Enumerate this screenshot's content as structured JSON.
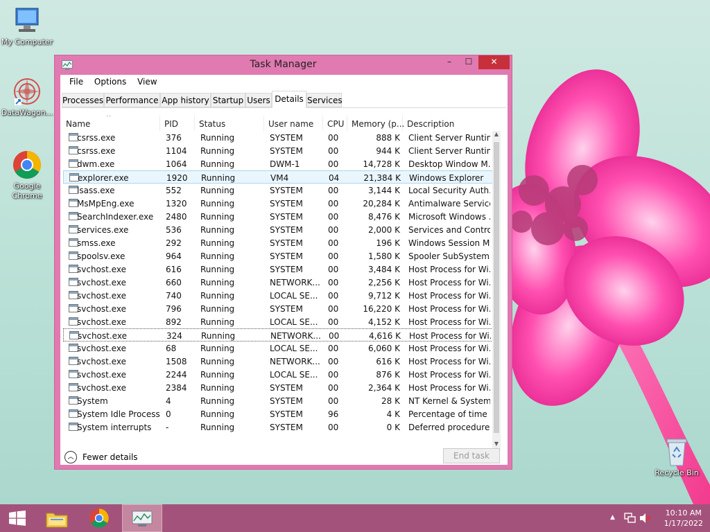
{
  "desktop": {
    "icons": [
      {
        "label": "My Computer"
      },
      {
        "label": "DataWagon..."
      },
      {
        "label": "Google Chrome"
      },
      {
        "label": "Recycle Bin"
      }
    ]
  },
  "window": {
    "title": "Task Manager",
    "controls": {
      "minimize": "–",
      "maximize": "☐",
      "close": "✕"
    },
    "menu": [
      "File",
      "Options",
      "View"
    ],
    "tabs": [
      {
        "label": "Processes",
        "active": false
      },
      {
        "label": "Performance",
        "active": false
      },
      {
        "label": "App history",
        "active": false
      },
      {
        "label": "Startup",
        "active": false
      },
      {
        "label": "Users",
        "active": false
      },
      {
        "label": "Details",
        "active": true
      },
      {
        "label": "Services",
        "active": false
      }
    ],
    "columns": [
      "Name",
      "PID",
      "Status",
      "User name",
      "CPU",
      "Memory (p...",
      "Description"
    ],
    "sort_indicator": "^",
    "rows": [
      {
        "name": "csrss.exe",
        "pid": "376",
        "status": "Running",
        "user": "SYSTEM",
        "cpu": "00",
        "mem": "888 K",
        "desc": "Client Server Runtim..."
      },
      {
        "name": "csrss.exe",
        "pid": "1104",
        "status": "Running",
        "user": "SYSTEM",
        "cpu": "00",
        "mem": "944 K",
        "desc": "Client Server Runtim..."
      },
      {
        "name": "dwm.exe",
        "pid": "1064",
        "status": "Running",
        "user": "DWM-1",
        "cpu": "00",
        "mem": "14,728 K",
        "desc": "Desktop Window M..."
      },
      {
        "name": "explorer.exe",
        "pid": "1920",
        "status": "Running",
        "user": "VM4",
        "cpu": "04",
        "mem": "21,384 K",
        "desc": "Windows Explorer"
      },
      {
        "name": "lsass.exe",
        "pid": "552",
        "status": "Running",
        "user": "SYSTEM",
        "cpu": "00",
        "mem": "3,144 K",
        "desc": "Local Security Auth..."
      },
      {
        "name": "MsMpEng.exe",
        "pid": "1320",
        "status": "Running",
        "user": "SYSTEM",
        "cpu": "00",
        "mem": "20,284 K",
        "desc": "Antimalware Service..."
      },
      {
        "name": "SearchIndexer.exe",
        "pid": "2480",
        "status": "Running",
        "user": "SYSTEM",
        "cpu": "00",
        "mem": "8,476 K",
        "desc": "Microsoft Windows ..."
      },
      {
        "name": "services.exe",
        "pid": "536",
        "status": "Running",
        "user": "SYSTEM",
        "cpu": "00",
        "mem": "2,000 K",
        "desc": "Services and Control..."
      },
      {
        "name": "smss.exe",
        "pid": "292",
        "status": "Running",
        "user": "SYSTEM",
        "cpu": "00",
        "mem": "196 K",
        "desc": "Windows Session M..."
      },
      {
        "name": "spoolsv.exe",
        "pid": "964",
        "status": "Running",
        "user": "SYSTEM",
        "cpu": "00",
        "mem": "1,580 K",
        "desc": "Spooler SubSystem ..."
      },
      {
        "name": "svchost.exe",
        "pid": "616",
        "status": "Running",
        "user": "SYSTEM",
        "cpu": "00",
        "mem": "3,484 K",
        "desc": "Host Process for Wi..."
      },
      {
        "name": "svchost.exe",
        "pid": "660",
        "status": "Running",
        "user": "NETWORK...",
        "cpu": "00",
        "mem": "2,256 K",
        "desc": "Host Process for Wi..."
      },
      {
        "name": "svchost.exe",
        "pid": "740",
        "status": "Running",
        "user": "LOCAL SE...",
        "cpu": "00",
        "mem": "9,712 K",
        "desc": "Host Process for Wi..."
      },
      {
        "name": "svchost.exe",
        "pid": "796",
        "status": "Running",
        "user": "SYSTEM",
        "cpu": "00",
        "mem": "16,220 K",
        "desc": "Host Process for Wi..."
      },
      {
        "name": "svchost.exe",
        "pid": "892",
        "status": "Running",
        "user": "LOCAL SE...",
        "cpu": "00",
        "mem": "4,152 K",
        "desc": "Host Process for Wi..."
      },
      {
        "name": "svchost.exe",
        "pid": "324",
        "status": "Running",
        "user": "NETWORK...",
        "cpu": "00",
        "mem": "4,616 K",
        "desc": "Host Process for Wi..."
      },
      {
        "name": "svchost.exe",
        "pid": "68",
        "status": "Running",
        "user": "LOCAL SE...",
        "cpu": "00",
        "mem": "6,060 K",
        "desc": "Host Process for Wi..."
      },
      {
        "name": "svchost.exe",
        "pid": "1508",
        "status": "Running",
        "user": "NETWORK...",
        "cpu": "00",
        "mem": "616 K",
        "desc": "Host Process for Wi..."
      },
      {
        "name": "svchost.exe",
        "pid": "2244",
        "status": "Running",
        "user": "LOCAL SE...",
        "cpu": "00",
        "mem": "876 K",
        "desc": "Host Process for Wi..."
      },
      {
        "name": "svchost.exe",
        "pid": "2384",
        "status": "Running",
        "user": "SYSTEM",
        "cpu": "00",
        "mem": "2,364 K",
        "desc": "Host Process for Wi..."
      },
      {
        "name": "System",
        "pid": "4",
        "status": "Running",
        "user": "SYSTEM",
        "cpu": "00",
        "mem": "28 K",
        "desc": "NT Kernel & System"
      },
      {
        "name": "System Idle Process",
        "pid": "0",
        "status": "Running",
        "user": "SYSTEM",
        "cpu": "96",
        "mem": "4 K",
        "desc": "Percentage of time t..."
      },
      {
        "name": "System interrupts",
        "pid": "-",
        "status": "Running",
        "user": "SYSTEM",
        "cpu": "00",
        "mem": "0 K",
        "desc": "Deferred procedure ..."
      }
    ],
    "selected_row": "explorer.exe",
    "focused_row_pid": "324",
    "fewer_details": "Fewer details",
    "end_task": "End task"
  },
  "taskbar": {
    "clock_time": "10:10 AM",
    "clock_date": "1/17/2022"
  },
  "colors": {
    "accent": "#e07ab0",
    "taskbar": "#a3537b",
    "close": "#c7303a"
  }
}
